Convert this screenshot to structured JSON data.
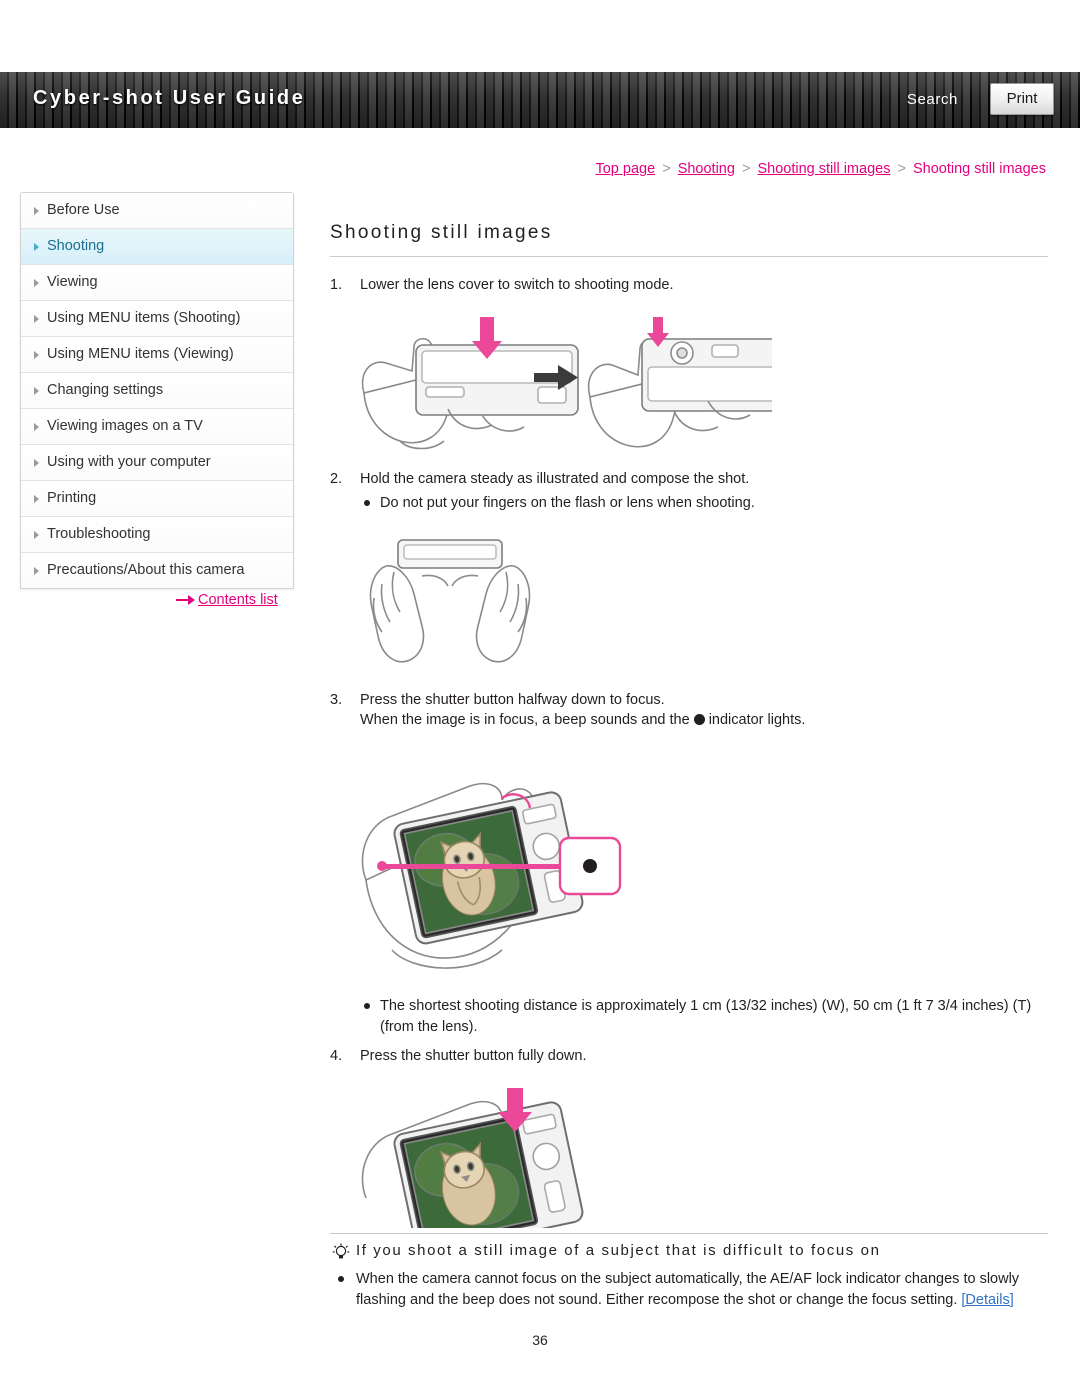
{
  "header": {
    "title": "Cyber-shot User Guide",
    "search_label": "Search",
    "print_label": "Print"
  },
  "breadcrumb": {
    "items": [
      "Top page",
      "Shooting",
      "Shooting still images",
      "Shooting still images"
    ],
    "separator": ">"
  },
  "sidebar": {
    "items": [
      {
        "label": "Before Use",
        "active": false
      },
      {
        "label": "Shooting",
        "active": true
      },
      {
        "label": "Viewing",
        "active": false
      },
      {
        "label": "Using MENU items (Shooting)",
        "active": false
      },
      {
        "label": "Using MENU items (Viewing)",
        "active": false
      },
      {
        "label": "Changing settings",
        "active": false
      },
      {
        "label": "Viewing images on a TV",
        "active": false
      },
      {
        "label": "Using with your computer",
        "active": false
      },
      {
        "label": "Printing",
        "active": false
      },
      {
        "label": "Troubleshooting",
        "active": false
      },
      {
        "label": "Precautions/About this camera",
        "active": false
      }
    ],
    "contents_list_label": "Contents list"
  },
  "main": {
    "title": "Shooting still images",
    "step1_num": "1.",
    "step1_text": "Lower the lens cover to switch to shooting mode.",
    "step2_num": "2.",
    "step2_text": "Hold the camera steady as illustrated and compose the shot.",
    "step2_bullet": "Do not put your fingers on the flash or lens when shooting.",
    "step3_num": "3.",
    "step3_text": "Press the shutter button halfway down to focus.",
    "step3_sub_a": "When the image is in focus, a beep sounds and the",
    "step3_sub_b": "indicator lights.",
    "step3_bullet": "The shortest shooting distance is approximately 1 cm (13/32 inches) (W), 50 cm (1 ft 7 3/4 inches) (T) (from the lens).",
    "step4_num": "4.",
    "step4_text": "Press the shutter button fully down."
  },
  "tip": {
    "title": "If you shoot a still image of a subject that is difficult to focus on",
    "body_before": "When the camera cannot focus on the subject automatically, the AE/AF lock indicator changes to slowly flashing and the beep does not sound. Either recompose the shot or change the focus setting.",
    "details_label": "[Details]"
  },
  "page_number": "36",
  "colors": {
    "accent_pink": "#e4007f",
    "link_blue": "#2f73c8",
    "sidebar_active_bg": "#d7eff8"
  }
}
